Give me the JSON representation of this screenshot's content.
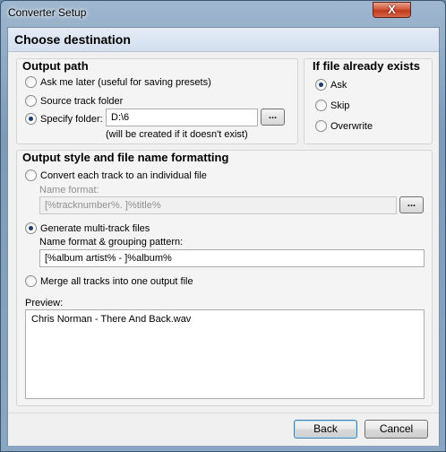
{
  "window": {
    "title": "Converter Setup",
    "close_label": "X"
  },
  "page_title": "Choose destination",
  "output_path": {
    "title": "Output path",
    "options": [
      {
        "label": "Ask me later (useful for saving presets)",
        "checked": false
      },
      {
        "label": "Source track folder",
        "checked": false
      },
      {
        "label": "Specify folder:",
        "checked": true
      }
    ],
    "folder_value": "D:\\6",
    "browse_label": "...",
    "note": "(will be created if it doesn't exist)"
  },
  "if_exists": {
    "title": "If file already exists",
    "options": [
      {
        "label": "Ask",
        "checked": true
      },
      {
        "label": "Skip",
        "checked": false
      },
      {
        "label": "Overwrite",
        "checked": false
      }
    ]
  },
  "output_style": {
    "title": "Output style and file name formatting",
    "individual": {
      "label": "Convert each track to an individual file",
      "checked": false
    },
    "name_format_label": "Name format:",
    "name_format_value": "[%tracknumber%. ]%title%",
    "name_format_browse": "...",
    "multitrack": {
      "label": "Generate multi-track files",
      "checked": true
    },
    "grouping_label": "Name format & grouping pattern:",
    "grouping_value": "[%album artist% - ]%album%",
    "merge": {
      "label": "Merge all tracks into one output file",
      "checked": false
    },
    "preview_label": "Preview:",
    "preview_value": "Chris Norman - There And Back.wav"
  },
  "footer": {
    "back_label": "Back",
    "cancel_label": "Cancel"
  }
}
